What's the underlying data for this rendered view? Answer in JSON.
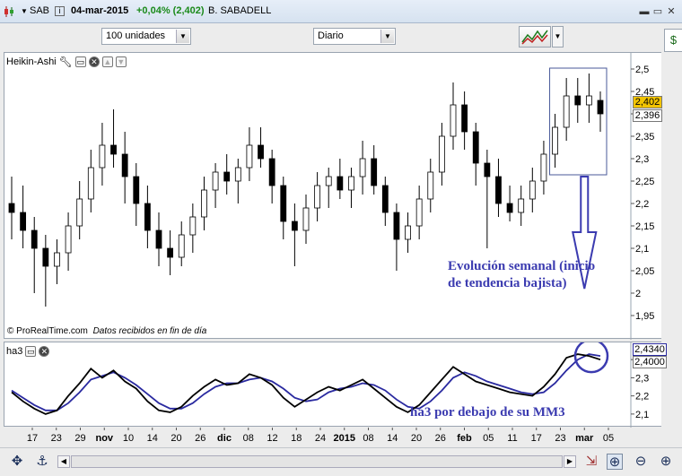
{
  "titlebar": {
    "symbol": "SAB",
    "date": "04-mar-2015",
    "change": "+0,04% (2,402)",
    "name": "B. SABADELL",
    "change_color": "#1a8a1a"
  },
  "toolbar": {
    "units": "100 unidades",
    "period": "Diario"
  },
  "main_panel": {
    "indicator": "Heikin-Ashi",
    "credit": "© ProRealTime.com",
    "credit_note": "Datos recibidos en fin de día",
    "last_price": "2,402",
    "prev_price": "2,396",
    "annotation_line1": "Evolución semanal (inicio",
    "annotation_line2": "de tendencia bajista)",
    "annotation_color": "#3b3bb0"
  },
  "sub_panel": {
    "indicator": "ha3",
    "value1": "2,4340",
    "value2": "2,4000",
    "annotation": "ha3 por debajo de su MM3",
    "annotation_color": "#3b3bb0"
  },
  "chart_data": [
    {
      "type": "candlestick",
      "title": "",
      "ylim": [
        1.92,
        2.52
      ],
      "yticks": [
        "2,5",
        "2,45",
        "2,4",
        "2,35",
        "2,3",
        "2,25",
        "2,2",
        "2,15",
        "2,1",
        "2,05",
        "2",
        "1,95"
      ],
      "ytick_values": [
        2.5,
        2.45,
        2.4,
        2.35,
        2.3,
        2.25,
        2.2,
        2.15,
        2.1,
        2.05,
        2.0,
        1.95
      ],
      "grid": false,
      "colors": {
        "up": "#ffffff",
        "down": "#000000",
        "wick": "#000000"
      },
      "xtick_labels": [
        "17",
        "23",
        "29",
        "nov",
        "10",
        "14",
        "20",
        "26",
        "dic",
        "08",
        "12",
        "18",
        "24",
        "2015",
        "08",
        "14",
        "20",
        "26",
        "feb",
        "05",
        "11",
        "17",
        "23",
        "mar",
        "05"
      ],
      "candles": [
        {
          "o": 2.2,
          "h": 2.26,
          "l": 2.12,
          "c": 2.18
        },
        {
          "o": 2.18,
          "h": 2.24,
          "l": 2.1,
          "c": 2.14
        },
        {
          "o": 2.14,
          "h": 2.17,
          "l": 2.0,
          "c": 2.1
        },
        {
          "o": 2.1,
          "h": 2.13,
          "l": 1.97,
          "c": 2.06
        },
        {
          "o": 2.06,
          "h": 2.12,
          "l": 2.02,
          "c": 2.09
        },
        {
          "o": 2.09,
          "h": 2.18,
          "l": 2.05,
          "c": 2.15
        },
        {
          "o": 2.15,
          "h": 2.25,
          "l": 2.12,
          "c": 2.21
        },
        {
          "o": 2.21,
          "h": 2.32,
          "l": 2.18,
          "c": 2.28
        },
        {
          "o": 2.28,
          "h": 2.38,
          "l": 2.24,
          "c": 2.33
        },
        {
          "o": 2.33,
          "h": 2.41,
          "l": 2.28,
          "c": 2.31
        },
        {
          "o": 2.31,
          "h": 2.36,
          "l": 2.2,
          "c": 2.26
        },
        {
          "o": 2.26,
          "h": 2.29,
          "l": 2.15,
          "c": 2.2
        },
        {
          "o": 2.2,
          "h": 2.24,
          "l": 2.1,
          "c": 2.14
        },
        {
          "o": 2.14,
          "h": 2.18,
          "l": 2.06,
          "c": 2.1
        },
        {
          "o": 2.1,
          "h": 2.14,
          "l": 2.04,
          "c": 2.08
        },
        {
          "o": 2.08,
          "h": 2.16,
          "l": 2.06,
          "c": 2.13
        },
        {
          "o": 2.13,
          "h": 2.2,
          "l": 2.09,
          "c": 2.17
        },
        {
          "o": 2.17,
          "h": 2.26,
          "l": 2.14,
          "c": 2.23
        },
        {
          "o": 2.23,
          "h": 2.29,
          "l": 2.19,
          "c": 2.27
        },
        {
          "o": 2.27,
          "h": 2.31,
          "l": 2.22,
          "c": 2.25
        },
        {
          "o": 2.25,
          "h": 2.3,
          "l": 2.2,
          "c": 2.28
        },
        {
          "o": 2.28,
          "h": 2.37,
          "l": 2.25,
          "c": 2.33
        },
        {
          "o": 2.33,
          "h": 2.37,
          "l": 2.28,
          "c": 2.3
        },
        {
          "o": 2.3,
          "h": 2.32,
          "l": 2.2,
          "c": 2.24
        },
        {
          "o": 2.24,
          "h": 2.26,
          "l": 2.12,
          "c": 2.16
        },
        {
          "o": 2.16,
          "h": 2.2,
          "l": 2.06,
          "c": 2.14
        },
        {
          "o": 2.14,
          "h": 2.22,
          "l": 2.11,
          "c": 2.19
        },
        {
          "o": 2.19,
          "h": 2.27,
          "l": 2.16,
          "c": 2.24
        },
        {
          "o": 2.24,
          "h": 2.28,
          "l": 2.19,
          "c": 2.26
        },
        {
          "o": 2.26,
          "h": 2.3,
          "l": 2.21,
          "c": 2.23
        },
        {
          "o": 2.23,
          "h": 2.28,
          "l": 2.19,
          "c": 2.26
        },
        {
          "o": 2.26,
          "h": 2.34,
          "l": 2.22,
          "c": 2.3
        },
        {
          "o": 2.3,
          "h": 2.33,
          "l": 2.22,
          "c": 2.24
        },
        {
          "o": 2.24,
          "h": 2.26,
          "l": 2.15,
          "c": 2.18
        },
        {
          "o": 2.18,
          "h": 2.2,
          "l": 2.05,
          "c": 2.12
        },
        {
          "o": 2.12,
          "h": 2.18,
          "l": 2.09,
          "c": 2.15
        },
        {
          "o": 2.15,
          "h": 2.24,
          "l": 2.12,
          "c": 2.21
        },
        {
          "o": 2.21,
          "h": 2.3,
          "l": 2.18,
          "c": 2.27
        },
        {
          "o": 2.27,
          "h": 2.38,
          "l": 2.24,
          "c": 2.35
        },
        {
          "o": 2.35,
          "h": 2.47,
          "l": 2.32,
          "c": 2.42
        },
        {
          "o": 2.42,
          "h": 2.45,
          "l": 2.32,
          "c": 2.36
        },
        {
          "o": 2.36,
          "h": 2.38,
          "l": 2.24,
          "c": 2.29
        },
        {
          "o": 2.29,
          "h": 2.32,
          "l": 2.1,
          "c": 2.26
        },
        {
          "o": 2.26,
          "h": 2.3,
          "l": 2.17,
          "c": 2.2
        },
        {
          "o": 2.2,
          "h": 2.24,
          "l": 2.16,
          "c": 2.18
        },
        {
          "o": 2.18,
          "h": 2.24,
          "l": 2.15,
          "c": 2.21
        },
        {
          "o": 2.21,
          "h": 2.28,
          "l": 2.18,
          "c": 2.25
        },
        {
          "o": 2.25,
          "h": 2.34,
          "l": 2.22,
          "c": 2.31
        },
        {
          "o": 2.31,
          "h": 2.4,
          "l": 2.28,
          "c": 2.37
        },
        {
          "o": 2.37,
          "h": 2.48,
          "l": 2.34,
          "c": 2.44
        },
        {
          "o": 2.44,
          "h": 2.48,
          "l": 2.38,
          "c": 2.42
        },
        {
          "o": 2.42,
          "h": 2.49,
          "l": 2.38,
          "c": 2.44
        },
        {
          "o": 2.43,
          "h": 2.45,
          "l": 2.36,
          "c": 2.4
        }
      ]
    },
    {
      "type": "line",
      "title": "",
      "ylim": [
        2.05,
        2.47
      ],
      "yticks": [
        "2,4",
        "2,3",
        "2,2",
        "2,1"
      ],
      "ytick_values": [
        2.4,
        2.3,
        2.2,
        2.1
      ],
      "grid": false,
      "series": [
        {
          "name": "ha3",
          "color": "#000000",
          "values": [
            2.22,
            2.17,
            2.13,
            2.1,
            2.12,
            2.2,
            2.27,
            2.35,
            2.3,
            2.34,
            2.28,
            2.24,
            2.17,
            2.12,
            2.11,
            2.14,
            2.2,
            2.25,
            2.29,
            2.26,
            2.27,
            2.32,
            2.3,
            2.26,
            2.19,
            2.14,
            2.18,
            2.22,
            2.25,
            2.23,
            2.26,
            2.29,
            2.24,
            2.19,
            2.14,
            2.11,
            2.15,
            2.22,
            2.29,
            2.36,
            2.32,
            2.28,
            2.26,
            2.24,
            2.22,
            2.21,
            2.2,
            2.25,
            2.32,
            2.41,
            2.43,
            2.42,
            2.4
          ]
        },
        {
          "name": "MM3",
          "color": "#2a2aa0",
          "values": [
            2.23,
            2.19,
            2.15,
            2.12,
            2.12,
            2.16,
            2.22,
            2.29,
            2.31,
            2.33,
            2.3,
            2.26,
            2.21,
            2.16,
            2.13,
            2.13,
            2.16,
            2.21,
            2.25,
            2.27,
            2.27,
            2.29,
            2.3,
            2.28,
            2.24,
            2.19,
            2.17,
            2.18,
            2.22,
            2.24,
            2.25,
            2.27,
            2.26,
            2.23,
            2.18,
            2.14,
            2.13,
            2.17,
            2.23,
            2.3,
            2.33,
            2.31,
            2.28,
            2.26,
            2.24,
            2.22,
            2.21,
            2.22,
            2.27,
            2.34,
            2.4,
            2.43,
            2.42
          ]
        }
      ]
    }
  ]
}
